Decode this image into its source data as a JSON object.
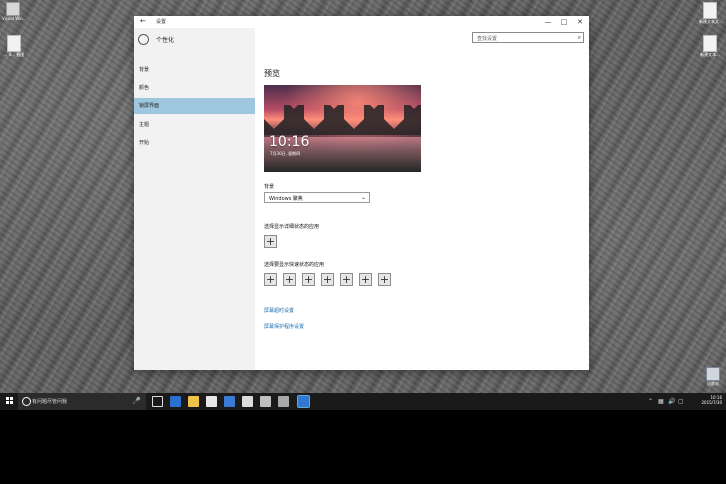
{
  "desktop": {
    "icons": [
      {
        "id": "left-top",
        "label": "Visual Win..."
      },
      {
        "id": "left-2",
        "label": "... 4... 截图"
      },
      {
        "id": "right-1",
        "label": "新建文本文..."
      },
      {
        "id": "right-2",
        "label": "新建文本..."
      },
      {
        "id": "recycle",
        "label": "回收站"
      }
    ]
  },
  "window": {
    "titlebar": {
      "title": "设置",
      "back": "←",
      "minimize": "—",
      "maximize": "□",
      "close": "✕"
    },
    "search": {
      "placeholder": "查找设置",
      "icon": "search-icon"
    },
    "sidebar": {
      "header": "个性化",
      "items": [
        {
          "label": "背景",
          "selected": false
        },
        {
          "label": "颜色",
          "selected": false
        },
        {
          "label": "锁屏界面",
          "selected": true
        },
        {
          "label": "主题",
          "selected": false
        },
        {
          "label": "开始",
          "selected": false
        }
      ]
    },
    "content": {
      "preview_heading": "预览",
      "preview": {
        "time": "10:16",
        "date": "7月30日, 星期四"
      },
      "background_label": "背景",
      "background_value": "Windows 聚焦",
      "detailed_status_label": "选择显示详细状态的应用",
      "quick_status_label": "选择要显示快速状态的应用",
      "plus_glyph": "+",
      "links": {
        "timeout": "屏幕超时设置",
        "screensaver": "屏幕保护程序设置"
      }
    }
  },
  "taskbar": {
    "search_placeholder": "有问题尽管问我",
    "mic": "🎤",
    "tray": {
      "clock_time": "10:16",
      "clock_date": "2015/7/30",
      "icons": [
        "chevron-up-icon",
        "network-icon",
        "volume-icon",
        "notification-icon"
      ]
    }
  }
}
